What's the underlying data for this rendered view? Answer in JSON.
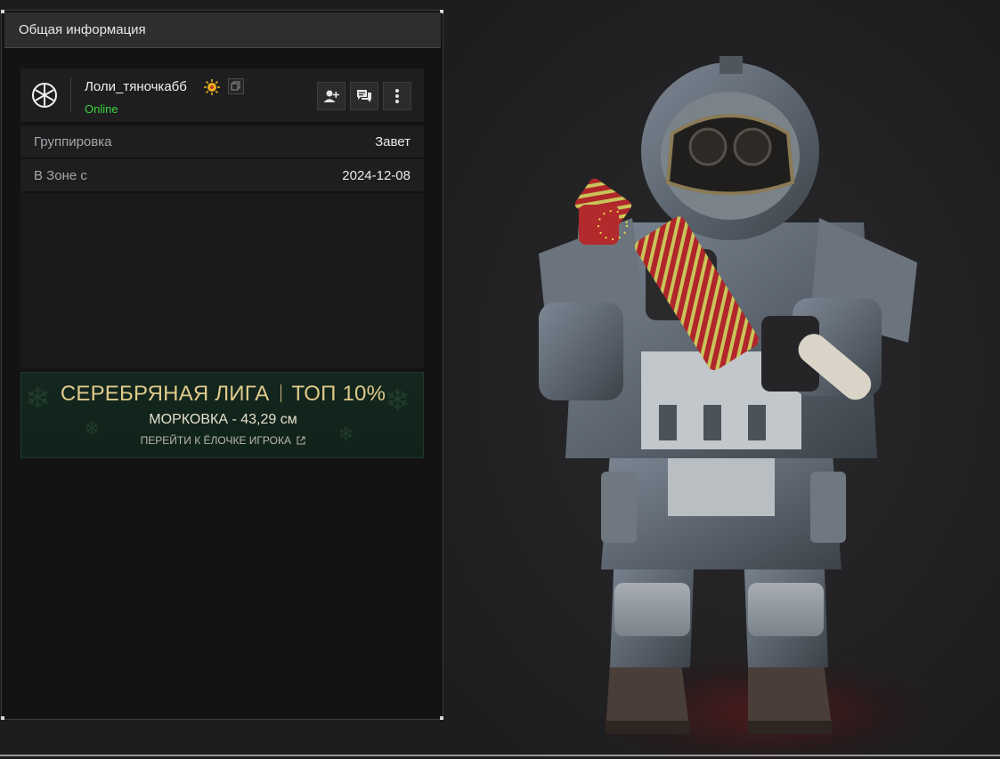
{
  "panel": {
    "title": "Общая информация"
  },
  "profile": {
    "name": "Лоли_тяночкабб",
    "status": "Online",
    "avatar_icon": "snowflake-icon",
    "badge_icon": "sun-badge-icon",
    "actions": [
      "add-friend-icon",
      "chat-icon",
      "more-icon"
    ]
  },
  "info": {
    "faction_label": "Группировка",
    "faction_value": "Завет",
    "zone_label": "В Зоне с",
    "zone_value": "2024-12-08"
  },
  "league": {
    "name": "СЕРЕБРЯНАЯ ЛИГА",
    "rank": "ТОП 10%",
    "carrot": "МОРКОВКА - 43,29 см",
    "link": "ПЕРЕЙТИ К ЁЛОЧКЕ ИГРОКА"
  },
  "colors": {
    "online": "#3bd23b",
    "league_gold": "#e0c98a",
    "banner_green": "#14271f"
  }
}
